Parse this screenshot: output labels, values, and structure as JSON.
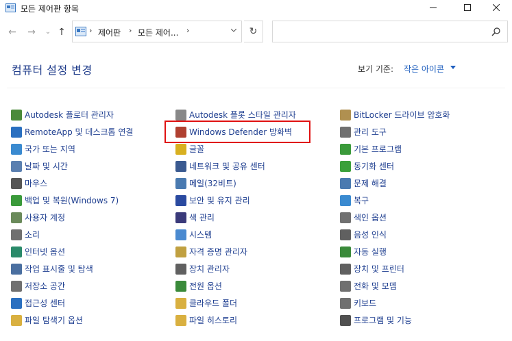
{
  "window": {
    "title": "모든 제어판 항목",
    "minimize": "—",
    "maximize": "☐",
    "close": "✕"
  },
  "nav": {
    "back": "←",
    "forward": "→",
    "up": "↑",
    "dropdown": "⌄",
    "breadcrumbs": [
      "제어판",
      "모든 제어..."
    ],
    "separator": "›",
    "refresh": "↻",
    "search_placeholder": ""
  },
  "main": {
    "heading": "컴퓨터 설정 변경",
    "view_by_label": "보기 기준:",
    "view_by_value": "작은 아이콘"
  },
  "columns": [
    [
      {
        "label": "Autodesk 플로터 관리자",
        "icon": "plotter-icon",
        "color": "#4a8a3a"
      },
      {
        "label": "RemoteApp 및 데스크톱 연결",
        "icon": "remoteapp-icon",
        "color": "#2a6fc0"
      },
      {
        "label": "국가 또는 지역",
        "icon": "globe-clock-icon",
        "color": "#3a8ad0"
      },
      {
        "label": "날짜 및 시간",
        "icon": "calendar-clock-icon",
        "color": "#5a7fb0"
      },
      {
        "label": "마우스",
        "icon": "mouse-icon",
        "color": "#555555"
      },
      {
        "label": "백업 및 복원(Windows 7)",
        "icon": "backup-icon",
        "color": "#3a9a3a"
      },
      {
        "label": "사용자 계정",
        "icon": "users-icon",
        "color": "#6a8a5a"
      },
      {
        "label": "소리",
        "icon": "speaker-icon",
        "color": "#707070"
      },
      {
        "label": "인터넷 옵션",
        "icon": "internet-icon",
        "color": "#2a8a6a"
      },
      {
        "label": "작업 표시줄 및 탐색",
        "icon": "taskbar-icon",
        "color": "#4a6fa0"
      },
      {
        "label": "저장소 공간",
        "icon": "storage-icon",
        "color": "#707070"
      },
      {
        "label": "접근성 센터",
        "icon": "accessibility-icon",
        "color": "#2a6fc0"
      },
      {
        "label": "파일 탐색기 옵션",
        "icon": "folder-options-icon",
        "color": "#d9b040"
      }
    ],
    [
      {
        "label": "Autodesk 플롯 스타일 관리자",
        "icon": "plot-style-icon",
        "color": "#888888"
      },
      {
        "label": "Windows Defender 방화벽",
        "icon": "firewall-icon",
        "color": "#b04030"
      },
      {
        "label": "글꼴",
        "icon": "fonts-icon",
        "color": "#d8b020"
      },
      {
        "label": "네트워크 및 공유 센터",
        "icon": "network-icon",
        "color": "#3a5a90"
      },
      {
        "label": "메일(32비트)",
        "icon": "mail-icon",
        "color": "#4a7ab0"
      },
      {
        "label": "보안 및 유지 관리",
        "icon": "flag-icon",
        "color": "#2a4aa0"
      },
      {
        "label": "색 관리",
        "icon": "color-management-icon",
        "color": "#3a3a7a"
      },
      {
        "label": "시스템",
        "icon": "system-icon",
        "color": "#4a8ad0"
      },
      {
        "label": "자격 증명 관리자",
        "icon": "credential-icon",
        "color": "#c0a040"
      },
      {
        "label": "장치 관리자",
        "icon": "device-manager-icon",
        "color": "#606060"
      },
      {
        "label": "전원 옵션",
        "icon": "power-icon",
        "color": "#3a8a3a"
      },
      {
        "label": "클라우드 폴더",
        "icon": "cloud-folder-icon",
        "color": "#d9b040"
      },
      {
        "label": "파일 히스토리",
        "icon": "file-history-icon",
        "color": "#d9b040"
      }
    ],
    [
      {
        "label": "BitLocker 드라이브 암호화",
        "icon": "bitlocker-icon",
        "color": "#b09050"
      },
      {
        "label": "관리 도구",
        "icon": "admin-tools-icon",
        "color": "#707070"
      },
      {
        "label": "기본 프로그램",
        "icon": "default-programs-icon",
        "color": "#3a9a3a"
      },
      {
        "label": "동기화 센터",
        "icon": "sync-icon",
        "color": "#3aa03a"
      },
      {
        "label": "문제 해결",
        "icon": "troubleshoot-icon",
        "color": "#4a7ab0"
      },
      {
        "label": "복구",
        "icon": "recovery-icon",
        "color": "#3a8ad0"
      },
      {
        "label": "색인 옵션",
        "icon": "indexing-icon",
        "color": "#707070"
      },
      {
        "label": "음성 인식",
        "icon": "microphone-icon",
        "color": "#606060"
      },
      {
        "label": "자동 실행",
        "icon": "autoplay-icon",
        "color": "#3a8a3a"
      },
      {
        "label": "장치 및 프린터",
        "icon": "printer-icon",
        "color": "#606060"
      },
      {
        "label": "전화 및 모뎀",
        "icon": "phone-modem-icon",
        "color": "#707070"
      },
      {
        "label": "키보드",
        "icon": "keyboard-icon",
        "color": "#707070"
      },
      {
        "label": "프로그램 및 기능",
        "icon": "programs-icon",
        "color": "#505050"
      }
    ]
  ],
  "highlight_color": "#e01010"
}
